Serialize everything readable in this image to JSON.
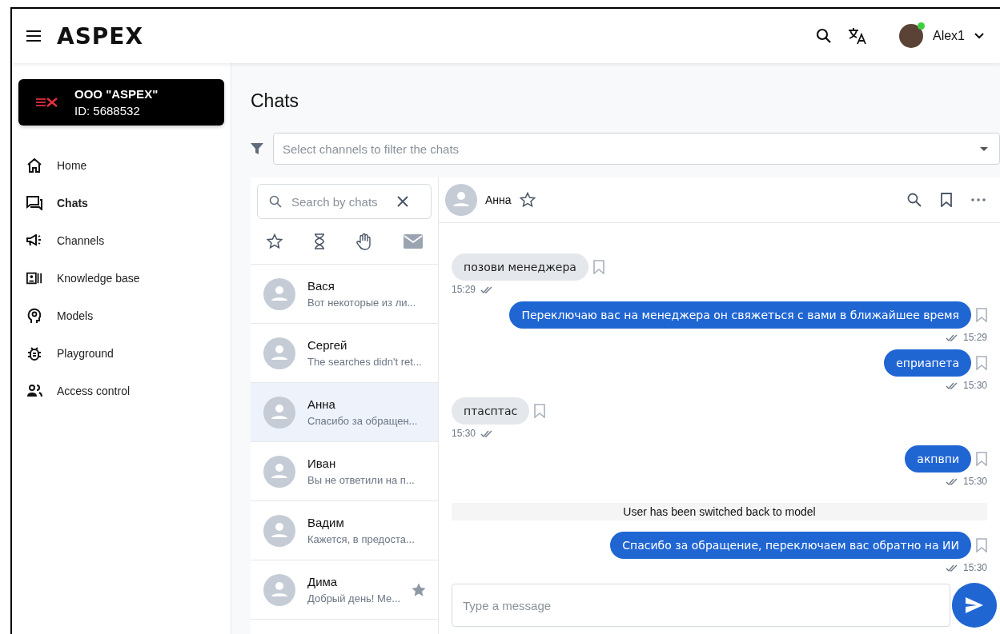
{
  "header": {
    "logo": "ASPEX",
    "user": {
      "name": "Alex1",
      "online": true
    }
  },
  "org": {
    "name": "OOO \"ASPEX\"",
    "id": "ID: 5688532"
  },
  "nav": [
    {
      "label": "Home",
      "selected": false
    },
    {
      "label": "Chats",
      "selected": true
    },
    {
      "label": "Channels",
      "selected": false
    },
    {
      "label": "Knowledge base",
      "selected": false
    },
    {
      "label": "Models",
      "selected": false
    },
    {
      "label": "Playground",
      "selected": false
    },
    {
      "label": "Access control",
      "selected": false
    }
  ],
  "page_title": "Chats",
  "filter": {
    "placeholder": "Select channels to filter the chats"
  },
  "chat_search": {
    "placeholder": "Search by chats"
  },
  "chats": [
    {
      "name": "Вася",
      "preview": "Вот некоторые из ли...",
      "selected": false,
      "starred": false
    },
    {
      "name": "Сергей",
      "preview": "The searches didn't ret...",
      "selected": false,
      "starred": false
    },
    {
      "name": "Анна",
      "preview": "Спасибо за обращен...",
      "selected": true,
      "starred": false
    },
    {
      "name": "Иван",
      "preview": "Вы не ответили на п...",
      "selected": false,
      "starred": false
    },
    {
      "name": "Вадим",
      "preview": "Кажется, в предоста...",
      "selected": false,
      "starred": false
    },
    {
      "name": "Дима",
      "preview": "Добрый день! Ме...",
      "selected": false,
      "starred": true
    }
  ],
  "conversation": {
    "contact": "Анна",
    "starred": false,
    "messages": [
      {
        "kind": "incoming",
        "text": "позови менеджера",
        "time": "15:29"
      },
      {
        "kind": "outgoing",
        "text": "Переключаю вас на менеджера он свяжеться с вами в ближайшее время",
        "time": "15:29"
      },
      {
        "kind": "outgoing",
        "text": "еприапета",
        "time": "15:30"
      },
      {
        "kind": "incoming",
        "text": "птасптас",
        "time": "15:30"
      },
      {
        "kind": "outgoing",
        "text": "акпвпи",
        "time": "15:30"
      },
      {
        "kind": "system",
        "text": "User has been switched back to model"
      },
      {
        "kind": "outgoing",
        "text": "Спасибо за обращение, переключаем вас обратно на ИИ",
        "time": "15:30"
      }
    ]
  },
  "composer": {
    "placeholder": "Type a message"
  }
}
